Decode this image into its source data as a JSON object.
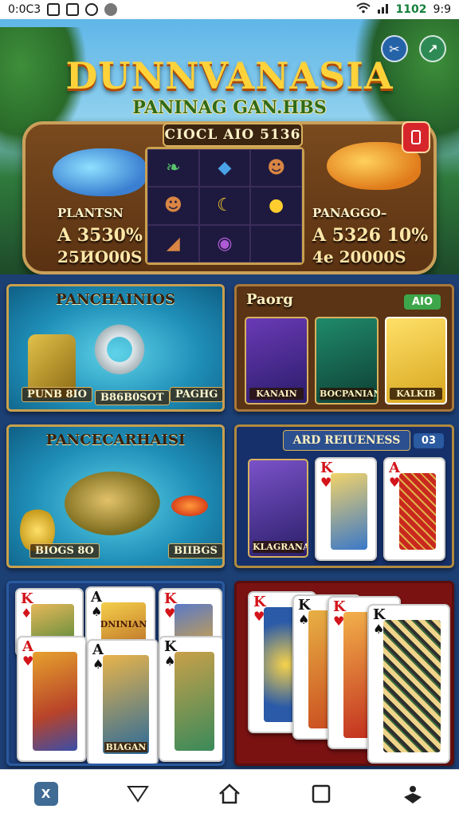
{
  "status_bar": {
    "time_left": "0:0C3",
    "time_right": "9:9",
    "battery": "1102"
  },
  "hero": {
    "title": "DUNNVANASIA",
    "subtitle": "PANINAG GAN.HBS",
    "machine_title": "CIOCL AIO 5136",
    "left_prize": {
      "name": "PLANTSN",
      "value": "A 3530%",
      "value2": "25ИО00S"
    },
    "right_prize": {
      "name": "PANAGGO–",
      "value": "A 5326 10%",
      "value2": "4e 20000S"
    },
    "share_icon": "share-icon",
    "exit_icon": "exit-icon",
    "mobile_icon": "mobile-icon"
  },
  "tiles": {
    "fish_1": {
      "title": "PANCHAINIOS",
      "label_left": "PUNB 8IO",
      "label_mid": "B86B0SOT",
      "label_right": "PAGHG"
    },
    "cards_1": {
      "title": "Paorg",
      "badge": "AIO",
      "thumbs": [
        "KANAIN",
        "BOCPANIAN",
        "KALKIB"
      ]
    },
    "fish_2": {
      "title": "PANCECARHAISI",
      "label_left": "BIOGS 8O",
      "label_right": "BIIBGS"
    },
    "cards_2": {
      "title": "ARD REIUENESS",
      "badge": "03",
      "thumb": "KLAGRANAS"
    },
    "cards_3": {
      "card_text": "DNINIAN",
      "card_caption": "BIAGAN"
    }
  },
  "nav": {
    "app_label": "X"
  },
  "colors": {
    "accent_gold": "#ffd23a",
    "panel_brown": "#5a3414",
    "panel_navy": "#15306a",
    "panel_red": "#7a1212",
    "badge_green": "#3da64a",
    "badge_blue": "#2a5aa0"
  }
}
